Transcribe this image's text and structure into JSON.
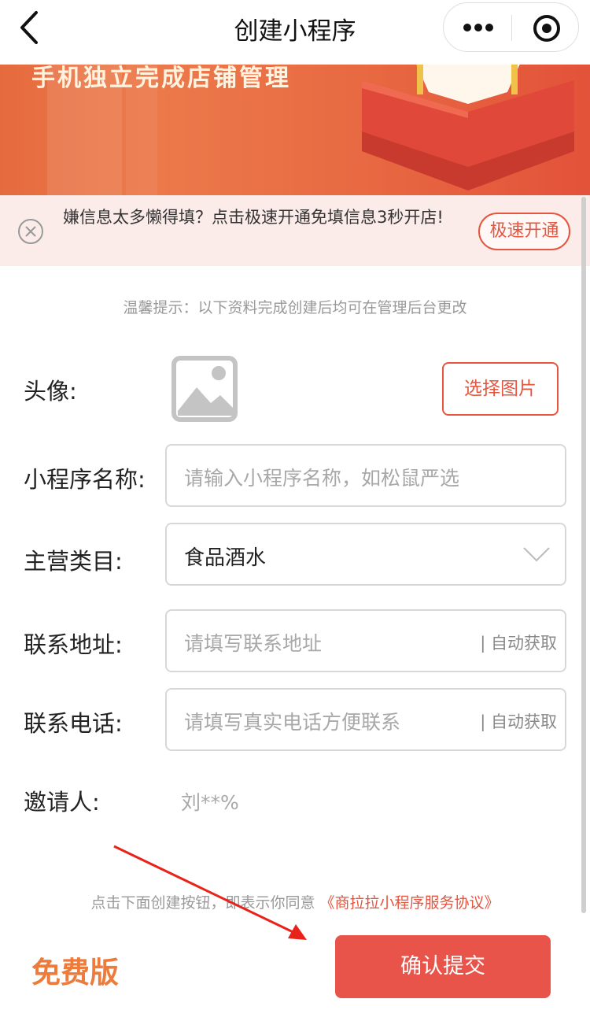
{
  "navbar": {
    "title": "创建小程序",
    "back_icon": "chevron-left-icon",
    "more_icon": "more-dots-icon",
    "close_icon": "target-circle-icon"
  },
  "banner": {
    "text": "手机独立完成店铺管理"
  },
  "tip": {
    "text": "嫌信息太多懒得填？点击极速开通免填信息3秒开店!",
    "button": "极速开通",
    "icon": "close-circle-icon"
  },
  "hint": "温馨提示：以下资料完成创建后均可在管理后台更改",
  "form": {
    "avatar_label": "头像:",
    "choose_image": "选择图片",
    "name_label": "小程序名称:",
    "name_placeholder": "请输入小程序名称，如松鼠严选",
    "category_label": "主营类目:",
    "category_value": "食品酒水",
    "address_label": "联系地址:",
    "address_placeholder": "请填写联系地址",
    "address_auto": "| 自动获取",
    "phone_label": "联系电话:",
    "phone_placeholder": "请填写真实电话方便联系",
    "phone_auto": "| 自动获取",
    "inviter_label": "邀请人:",
    "inviter_value": "刘**%"
  },
  "agreement": {
    "text": "点击下面创建按钮，即表示你同意",
    "link": "《商拉拉小程序服务协议》"
  },
  "footer": {
    "plan": "免费版",
    "submit": "确认提交"
  },
  "colors": {
    "accent": "#e5553f",
    "submit_bg": "#e8544a",
    "plan": "#ec7b3c",
    "tip_bg": "#fbecea"
  }
}
